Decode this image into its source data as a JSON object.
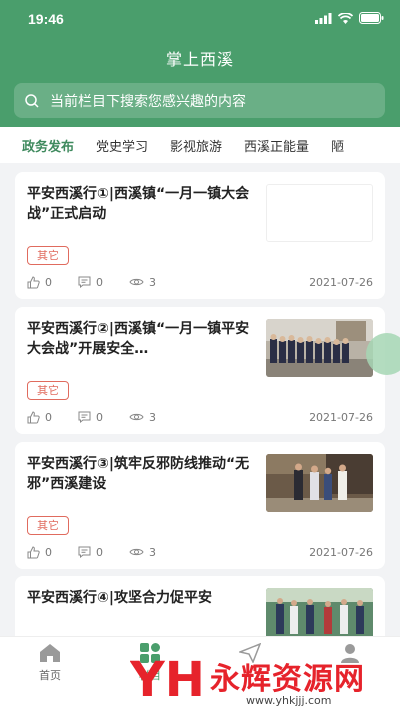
{
  "status_bar": {
    "time": "19:46"
  },
  "header": {
    "title": "掌上西溪",
    "search_placeholder": "当前栏目下搜索您感兴趣的内容"
  },
  "tabs": [
    {
      "label": "政务发布"
    },
    {
      "label": "党史学习"
    },
    {
      "label": "影视旅游"
    },
    {
      "label": "西溪正能量"
    },
    {
      "label": "陋"
    }
  ],
  "articles": [
    {
      "title": "平安西溪行①|西溪镇“一月一镇大会战”正式启动",
      "tag": "其它",
      "likes": "0",
      "comments": "0",
      "views": "3",
      "date": "2021-07-26"
    },
    {
      "title": "平安西溪行②|西溪镇“一月一镇平安大会战”开展安全…",
      "tag": "其它",
      "likes": "0",
      "comments": "0",
      "views": "3",
      "date": "2021-07-26"
    },
    {
      "title": "平安西溪行③|筑牢反邪防线推动“无邪”西溪建设",
      "tag": "其它",
      "likes": "0",
      "comments": "0",
      "views": "3",
      "date": "2021-07-26"
    },
    {
      "title": "平安西溪行④|攻坚合力促平安"
    }
  ],
  "tabbar": {
    "home_label": "首页",
    "column_label": "栏目"
  },
  "watermark": {
    "text": "永辉资源网",
    "url": "www.yhkjjj.com"
  },
  "colors": {
    "brand_green": "#4a9e6c",
    "tag_red": "#e06b5e"
  }
}
